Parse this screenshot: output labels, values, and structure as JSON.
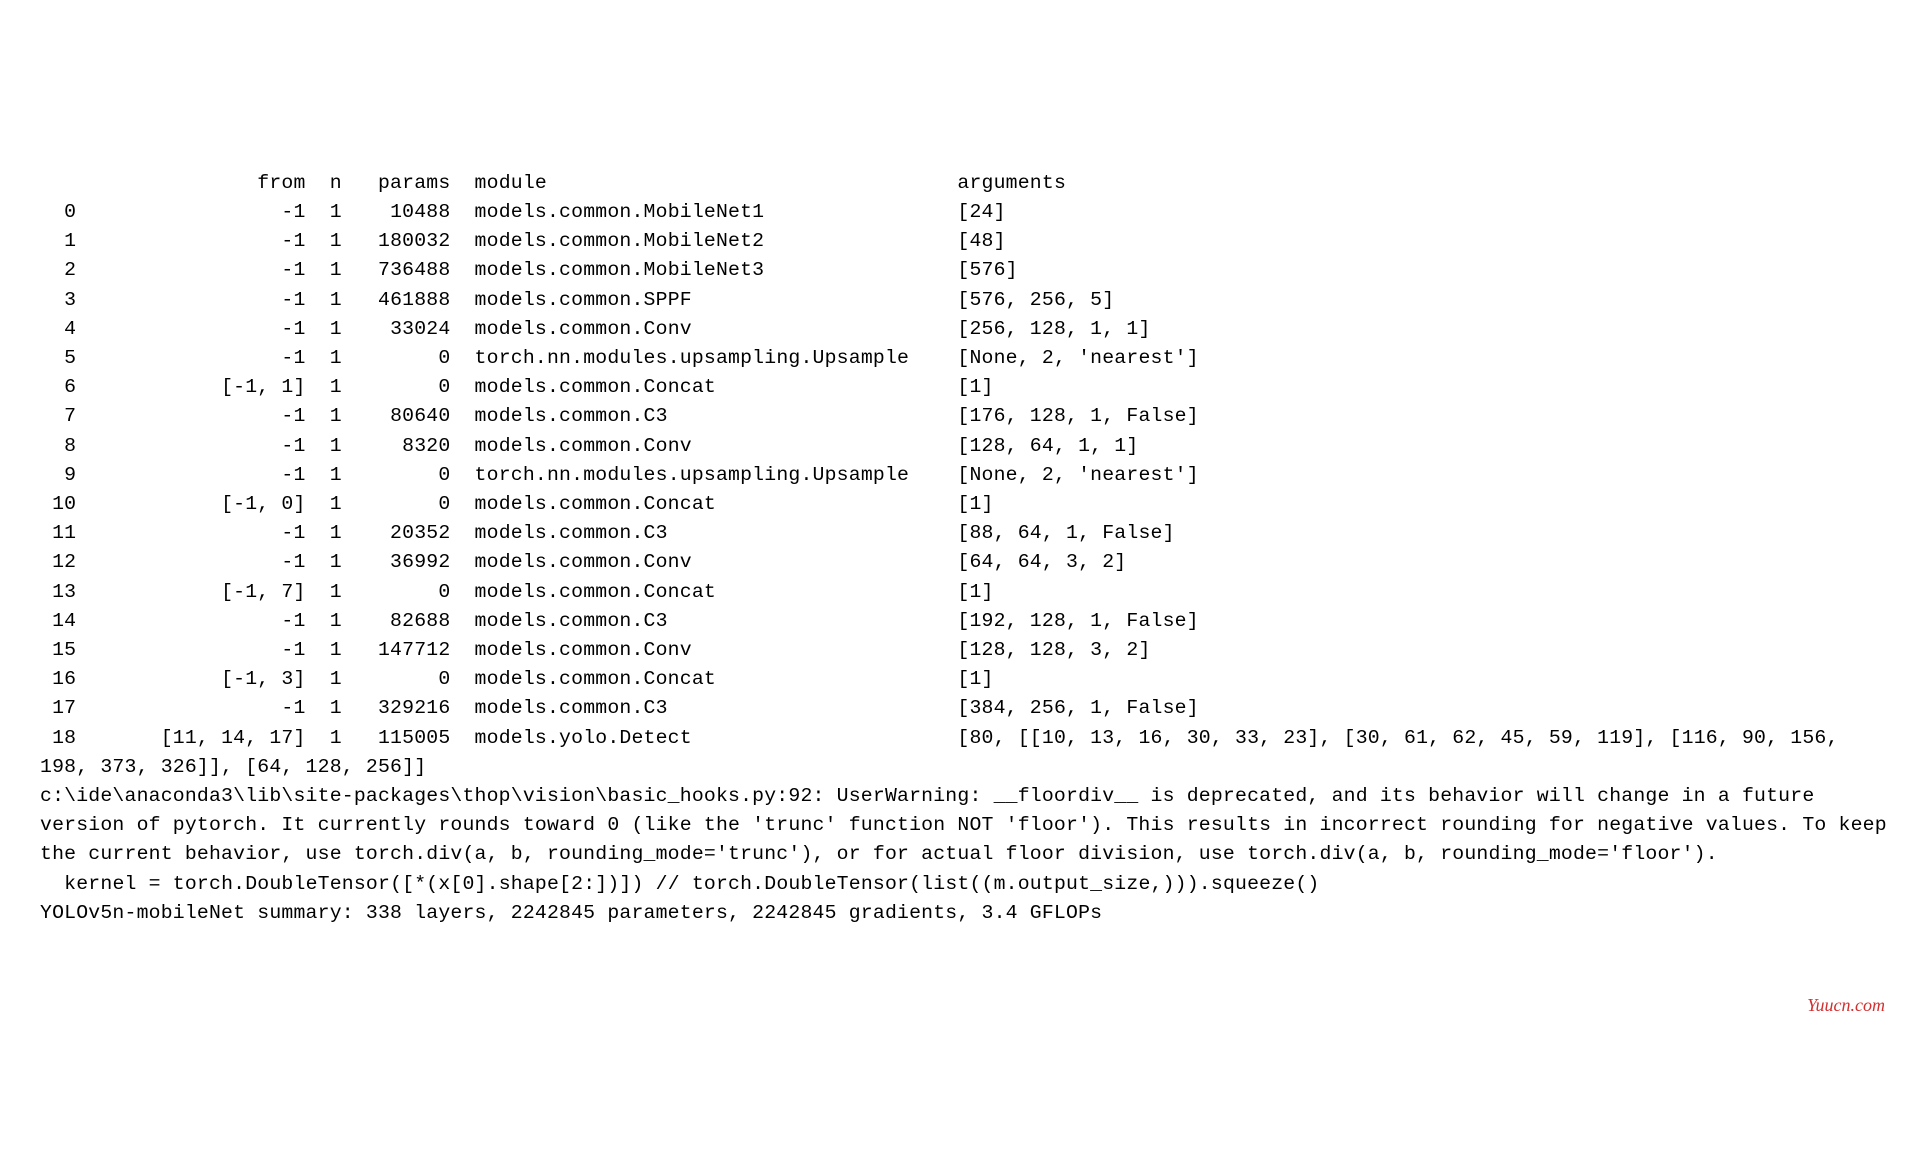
{
  "header": {
    "col_idx": "",
    "col_from": "from",
    "col_n": "n",
    "col_params": "params",
    "col_module": "module",
    "col_arguments": "arguments"
  },
  "rows": [
    {
      "idx": "0",
      "from": "-1",
      "n": "1",
      "params": "10488",
      "module": "models.common.MobileNet1",
      "arguments": "[24]"
    },
    {
      "idx": "1",
      "from": "-1",
      "n": "1",
      "params": "180032",
      "module": "models.common.MobileNet2",
      "arguments": "[48]"
    },
    {
      "idx": "2",
      "from": "-1",
      "n": "1",
      "params": "736488",
      "module": "models.common.MobileNet3",
      "arguments": "[576]"
    },
    {
      "idx": "3",
      "from": "-1",
      "n": "1",
      "params": "461888",
      "module": "models.common.SPPF",
      "arguments": "[576, 256, 5]"
    },
    {
      "idx": "4",
      "from": "-1",
      "n": "1",
      "params": "33024",
      "module": "models.common.Conv",
      "arguments": "[256, 128, 1, 1]"
    },
    {
      "idx": "5",
      "from": "-1",
      "n": "1",
      "params": "0",
      "module": "torch.nn.modules.upsampling.Upsample",
      "arguments": "[None, 2, 'nearest']"
    },
    {
      "idx": "6",
      "from": "[-1, 1]",
      "n": "1",
      "params": "0",
      "module": "models.common.Concat",
      "arguments": "[1]"
    },
    {
      "idx": "7",
      "from": "-1",
      "n": "1",
      "params": "80640",
      "module": "models.common.C3",
      "arguments": "[176, 128, 1, False]"
    },
    {
      "idx": "8",
      "from": "-1",
      "n": "1",
      "params": "8320",
      "module": "models.common.Conv",
      "arguments": "[128, 64, 1, 1]"
    },
    {
      "idx": "9",
      "from": "-1",
      "n": "1",
      "params": "0",
      "module": "torch.nn.modules.upsampling.Upsample",
      "arguments": "[None, 2, 'nearest']"
    },
    {
      "idx": "10",
      "from": "[-1, 0]",
      "n": "1",
      "params": "0",
      "module": "models.common.Concat",
      "arguments": "[1]"
    },
    {
      "idx": "11",
      "from": "-1",
      "n": "1",
      "params": "20352",
      "module": "models.common.C3",
      "arguments": "[88, 64, 1, False]"
    },
    {
      "idx": "12",
      "from": "-1",
      "n": "1",
      "params": "36992",
      "module": "models.common.Conv",
      "arguments": "[64, 64, 3, 2]"
    },
    {
      "idx": "13",
      "from": "[-1, 7]",
      "n": "1",
      "params": "0",
      "module": "models.common.Concat",
      "arguments": "[1]"
    },
    {
      "idx": "14",
      "from": "-1",
      "n": "1",
      "params": "82688",
      "module": "models.common.C3",
      "arguments": "[192, 128, 1, False]"
    },
    {
      "idx": "15",
      "from": "-1",
      "n": "1",
      "params": "147712",
      "module": "models.common.Conv",
      "arguments": "[128, 128, 3, 2]"
    },
    {
      "idx": "16",
      "from": "[-1, 3]",
      "n": "1",
      "params": "0",
      "module": "models.common.Concat",
      "arguments": "[1]"
    },
    {
      "idx": "17",
      "from": "-1",
      "n": "1",
      "params": "329216",
      "module": "models.common.C3",
      "arguments": "[384, 256, 1, False]"
    },
    {
      "idx": "18",
      "from": "[11, 14, 17]",
      "n": "1",
      "params": "115005",
      "module": "models.yolo.Detect",
      "arguments": "[80, [[10, 13, 16, 30, 33, 23], [30, 61, 62, 45, 59, 119], [116, 90, 156, 198, 373, 326]], [64, 128, 256]]"
    }
  ],
  "warning": "c:\\ide\\anaconda3\\lib\\site-packages\\thop\\vision\\basic_hooks.py:92: UserWarning: __floordiv__ is deprecated, and its behavior will change in a future version of pytorch. It currently rounds toward 0 (like the 'trunc' function NOT 'floor'). This results in incorrect rounding for negative values. To keep the current behavior, use torch.div(a, b, rounding_mode='trunc'), or for actual floor division, use torch.div(a, b, rounding_mode='floor').",
  "kernel_line": "  kernel = torch.DoubleTensor([*(x[0].shape[2:])]) // torch.DoubleTensor(list((m.output_size,))).squeeze()",
  "summary": "YOLOv5n-mobileNet summary: 338 layers, 2242845 parameters, 2242845 gradients, 3.4 GFLOPs",
  "watermark": "Yuucn.com",
  "col_widths": {
    "idx": 3,
    "from": 19,
    "n": 3,
    "params": 9,
    "module": 40,
    "arguments": 0
  }
}
